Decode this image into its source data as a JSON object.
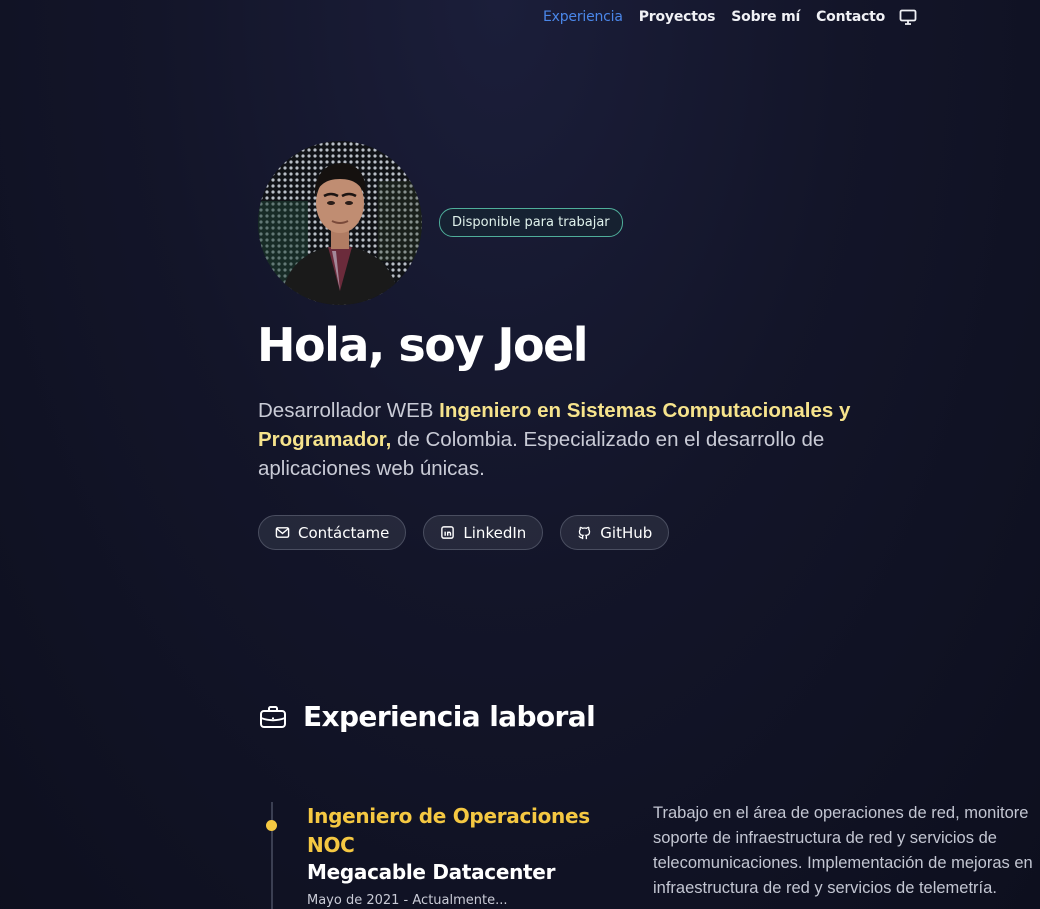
{
  "nav": {
    "items": [
      "Experiencia",
      "Proyectos",
      "Sobre mí",
      "Contacto"
    ],
    "active": "Experiencia",
    "theme_icon": "monitor-icon"
  },
  "hero": {
    "badge": "Disponible para trabajar",
    "title": "Hola, soy Joel",
    "desc_prefix": "Desarrollador WEB ",
    "desc_highlight": "Ingeniero en Sistemas Computacionales y Programador,",
    "desc_suffix": " de Colombia. Especializado en el desarrollo de aplicaciones web únicas.",
    "buttons": [
      {
        "label": "Contáctame",
        "icon": "mail-icon"
      },
      {
        "label": "LinkedIn",
        "icon": "linkedin-icon"
      },
      {
        "label": "GitHub",
        "icon": "github-icon"
      }
    ]
  },
  "experience": {
    "title": "Experiencia laboral",
    "icon": "briefcase-icon",
    "jobs": [
      {
        "role": "Ingeniero de Operaciones NOC",
        "company": "Megacable Datacenter",
        "date": "Mayo de 2021 - Actualmente...",
        "desc_lines": [
          "Trabajo en el área de operaciones de red, monitore",
          "soporte de infraestructura de red y servicios de",
          "telecomunicaciones. Implementación de mejoras en",
          "infraestructura de red y servicios de telemetría."
        ]
      }
    ]
  },
  "colors": {
    "accent_blue": "#4a86e8",
    "highlight_yellow": "#f6e38c",
    "timeline_yellow": "#f5c842",
    "badge_border": "#4fae9a"
  }
}
